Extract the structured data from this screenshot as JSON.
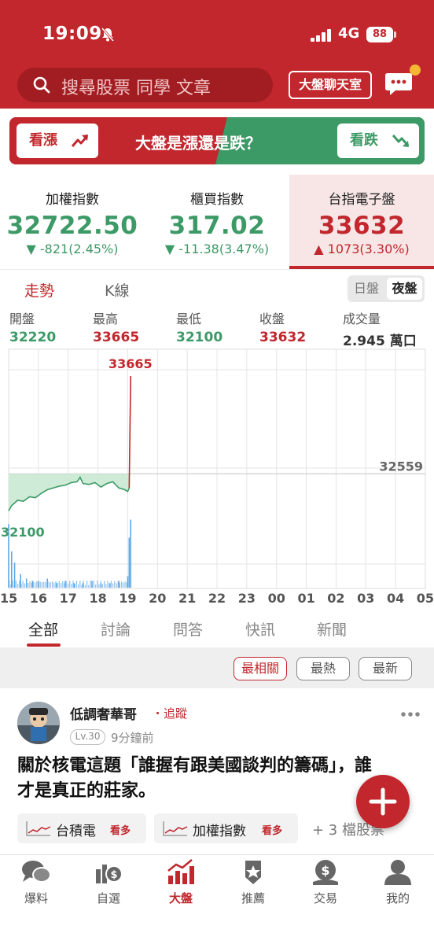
{
  "status_bar": {
    "time": "19:09",
    "network": "4G",
    "battery": "88"
  },
  "header": {
    "search_placeholder": "搜尋股票 同學 文章",
    "chatroom_label": "大盤聊天室"
  },
  "banner": {
    "bull_label": "看漲",
    "question": "大盤是漲還是跌？",
    "bear_label": "看跌"
  },
  "indices": [
    {
      "name": "加權指數",
      "value": "32722.50",
      "change": "▼ -821(2.45%)",
      "trend": "down"
    },
    {
      "name": "櫃買指數",
      "value": "317.02",
      "change": "▼ -11.38(3.47%)",
      "trend": "down"
    },
    {
      "name": "台指電子盤",
      "value": "33632",
      "change": "▲ 1073(3.30%)",
      "trend": "up"
    }
  ],
  "chart_tabs": {
    "trend": "走勢",
    "kline": "K線",
    "day_session": "日盤",
    "night_session": "夜盤"
  },
  "quote": {
    "open_label": "開盤",
    "open": "32220",
    "high_label": "最高",
    "high": "33665",
    "low_label": "最低",
    "low": "32100",
    "close_label": "收盤",
    "close": "33632",
    "volume_label": "成交量",
    "volume": "2.945 萬口"
  },
  "chart_data": {
    "type": "line",
    "title": "",
    "xlabel": "",
    "ylabel": "",
    "x_ticks": [
      "15",
      "16",
      "17",
      "18",
      "19",
      "20",
      "21",
      "22",
      "23",
      "00",
      "01",
      "02",
      "03",
      "04",
      "05"
    ],
    "reference_price": 32559,
    "high_label": "33665",
    "low_label": "32100",
    "ref_label": "32559",
    "ylim": [
      32100,
      33665
    ],
    "series": [
      {
        "x": [
          15.0,
          15.1,
          15.2,
          15.3,
          15.5,
          15.7,
          15.9,
          16.1,
          16.3,
          16.5,
          16.7,
          16.9,
          17.1,
          17.3,
          17.4,
          17.5,
          17.7,
          17.9,
          18.1,
          18.3,
          18.5,
          18.7,
          18.9,
          19.0,
          19.05,
          19.1
        ],
        "y": [
          32140,
          32200,
          32230,
          32260,
          32250,
          32300,
          32290,
          32340,
          32380,
          32400,
          32420,
          32430,
          32460,
          32470,
          32520,
          32450,
          32440,
          32460,
          32410,
          32450,
          32470,
          32400,
          32380,
          32360,
          32400,
          33665
        ]
      }
    ],
    "volume": {
      "x": [
        15.0,
        15.1,
        15.2,
        15.4,
        15.6,
        15.8,
        16.0,
        16.3,
        16.6,
        16.9,
        17.2,
        17.5,
        17.8,
        18.1,
        18.4,
        18.7,
        19.0,
        19.05,
        19.1
      ],
      "v": [
        2.8,
        1.6,
        1.1,
        0.6,
        0.4,
        0.3,
        0.3,
        0.4,
        0.2,
        0.3,
        0.2,
        0.2,
        0.3,
        0.2,
        0.2,
        0.3,
        0.5,
        2.2,
        3.0
      ]
    }
  },
  "feed_tabs": [
    "全部",
    "討論",
    "問答",
    "快訊",
    "新聞"
  ],
  "sort_options": [
    "最相關",
    "最熱",
    "最新"
  ],
  "post": {
    "author": "低調奢華哥",
    "follow": "・追蹤",
    "level": "Lv.30",
    "time": "9分鐘前",
    "title": "關於核電這題「誰握有跟美國談判的籌碼」，誰才是真正的莊家。",
    "stocks": [
      {
        "name": "台積電",
        "more": "看多"
      },
      {
        "name": "加權指數",
        "more": "看多"
      }
    ],
    "more_stocks": "+ 3 檔股票"
  },
  "bottom_nav": [
    {
      "label": "爆料",
      "icon": "chat-bubbles-icon"
    },
    {
      "label": "自選",
      "icon": "watchlist-icon"
    },
    {
      "label": "大盤",
      "icon": "market-chart-icon"
    },
    {
      "label": "推薦",
      "icon": "shield-star-icon"
    },
    {
      "label": "交易",
      "icon": "money-bag-icon"
    },
    {
      "label": "我的",
      "icon": "person-icon"
    }
  ],
  "colors": {
    "brand": "#c1272d",
    "up": "#c1272d",
    "down": "#3c9a66",
    "volume": "#5fa8e8"
  }
}
